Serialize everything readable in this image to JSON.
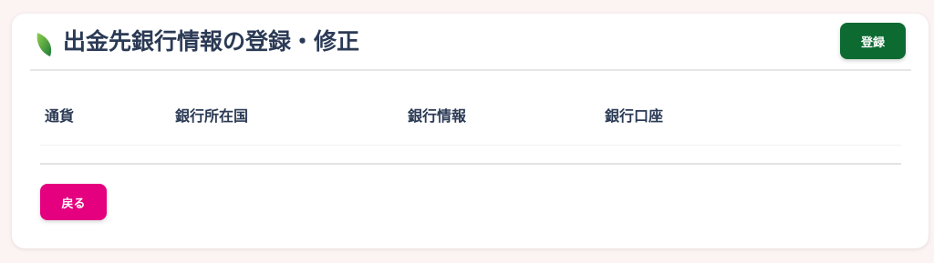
{
  "page": {
    "title": "出金先銀行情報の登録・修正",
    "icon": "leaf-icon"
  },
  "actions": {
    "register_label": "登録",
    "back_label": "戻る"
  },
  "table": {
    "columns": [
      "通貨",
      "銀行所在国",
      "銀行情報",
      "銀行口座"
    ],
    "rows": []
  },
  "colors": {
    "background": "#fcf3f3",
    "title_text": "#2b3a55",
    "register_button": "#0d6b32",
    "back_button": "#e4007f",
    "leaf_light": "#7cc242",
    "leaf_dark": "#1f7a3a"
  }
}
